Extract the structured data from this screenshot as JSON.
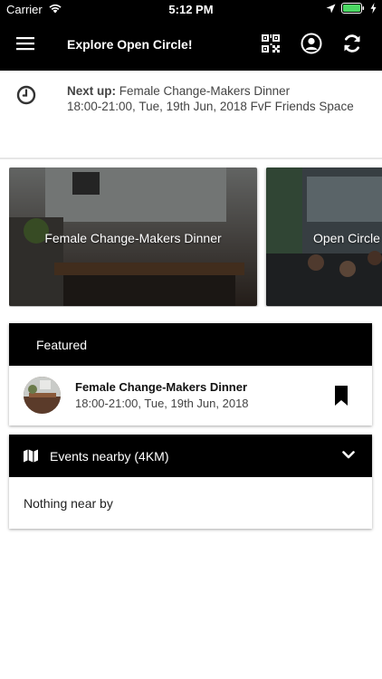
{
  "status_bar": {
    "carrier": "Carrier",
    "time": "5:12 PM"
  },
  "nav": {
    "title": "Explore Open Circle!"
  },
  "next_up": {
    "label": "Next up:",
    "event_name": "Female Change-Makers Dinner",
    "details": "18:00-21:00, Tue, 19th Jun, 2018 FvF Friends Space"
  },
  "cards": [
    {
      "label": "Female Change-Makers Dinner"
    },
    {
      "label": "Open Circle"
    }
  ],
  "featured": {
    "header": "Featured",
    "item": {
      "title": "Female Change-Makers Dinner",
      "subtitle": "18:00-21:00, Tue, 19th Jun, 2018"
    }
  },
  "nearby": {
    "header": "Events nearby (4KM)",
    "empty_text": "Nothing near by"
  }
}
